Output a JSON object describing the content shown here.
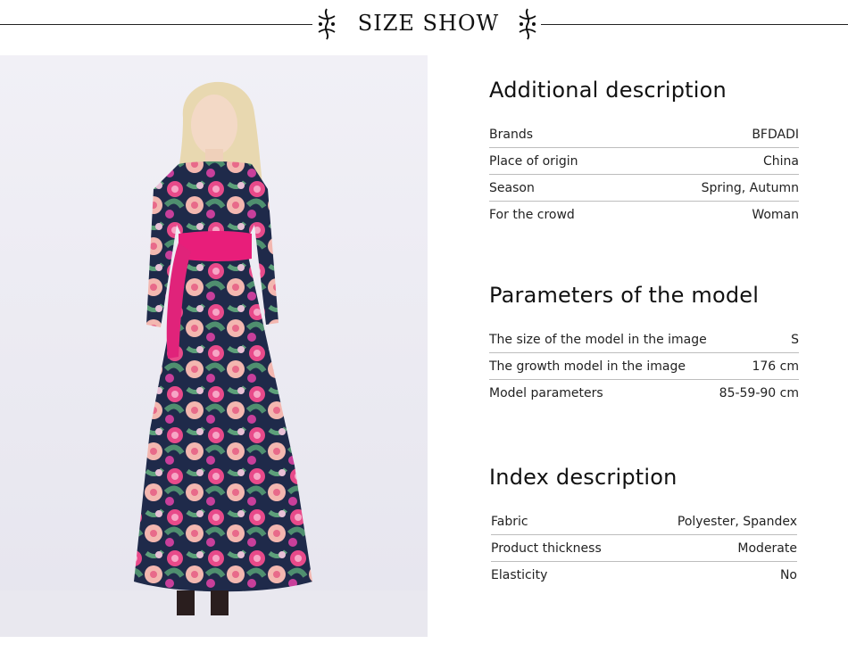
{
  "header": {
    "title": "SIZE SHOW"
  },
  "additional": {
    "heading": "Additional description",
    "rows": [
      {
        "label": "Brands",
        "value": "BFDADI"
      },
      {
        "label": "Place of origin",
        "value": "China"
      },
      {
        "label": "Season",
        "value": "Spring, Autumn"
      },
      {
        "label": "For the crowd",
        "value": "Woman"
      }
    ]
  },
  "model": {
    "heading": "Parameters of the model",
    "rows": [
      {
        "label": "The size of the model in the image",
        "value": "S"
      },
      {
        "label": "The growth model in the image",
        "value": "176 cm"
      },
      {
        "label": "Model parameters",
        "value": "85-59-90 cm"
      }
    ]
  },
  "index": {
    "heading": "Index description",
    "rows": [
      {
        "label": "Fabric",
        "value": "Polyester, Spandex"
      },
      {
        "label": "Product thickness",
        "value": "Moderate"
      },
      {
        "label": "Elasticity",
        "value": "No"
      }
    ]
  },
  "colors": {
    "dress_base": "#1f2a4a",
    "sash": "#e81e7a",
    "rose": "#e84a8a",
    "leaf": "#4f8f6f",
    "bg": "#ecebf3"
  }
}
